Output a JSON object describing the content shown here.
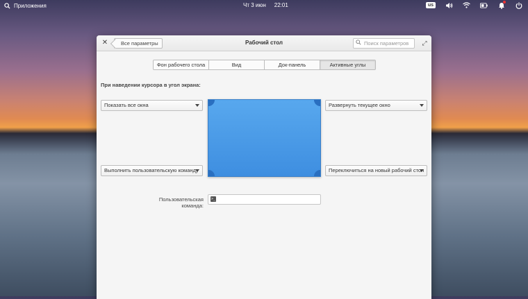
{
  "topbar": {
    "applications_label": "Приложения",
    "date": "Чт 3 июн",
    "time": "22:01",
    "keyboard_layout": "us"
  },
  "window": {
    "title": "Рабочий стол",
    "back_label": "Все параметры",
    "search_placeholder": "Поиск параметров",
    "tabs": [
      {
        "label": "Фон рабочего стола"
      },
      {
        "label": "Вид"
      },
      {
        "label": "Док-панель"
      },
      {
        "label": "Активные углы"
      }
    ],
    "active_tab_index": 3,
    "hint": "При наведении курсора в угол экрана:",
    "corners": {
      "top_left": "Показать все окна",
      "bottom_left": "Выполнить пользовательскую команду",
      "top_right": "Развернуть текущее окно",
      "bottom_right": "Переключиться на новый рабочий стол"
    },
    "custom_command_label": "Пользовательская команда:",
    "custom_command_value": ""
  },
  "colors": {
    "preview_blue": "#4a9de6",
    "preview_corner": "#2a6fc0"
  }
}
